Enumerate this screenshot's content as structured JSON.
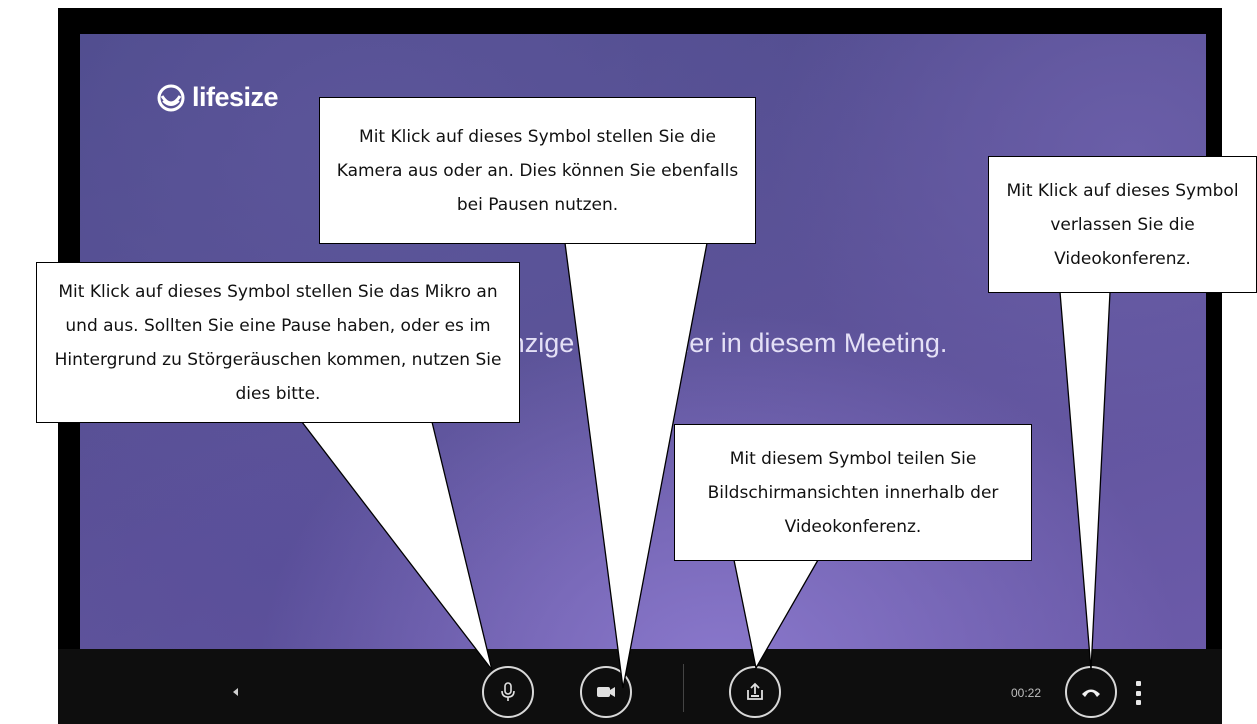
{
  "app": {
    "logo_text": "lifesize"
  },
  "meeting": {
    "message": "Sie sind der einzige Teilnehmer in diesem Meeting."
  },
  "toolbar": {
    "timer": "00:22"
  },
  "icons": {
    "logo": "lifesize-logo-icon",
    "collapse": "triangle-left-icon",
    "mic": "microphone-icon",
    "camera": "video-camera-icon",
    "share": "screen-share-icon",
    "hangup": "phone-hangup-icon",
    "more": "more-vertical-icon"
  },
  "callouts": {
    "mic": "Mit Klick auf dieses Symbol stellen Sie das Mikro an und aus. Sollten Sie eine Pause haben, oder es im Hintergrund zu Störge­räuschen kommen, nutzen Sie dies bitte.",
    "camera": "Mit Klick auf dieses Symbol stellen Sie die Kamera aus oder an. Dies können Sie ebenfalls bei Pausen nutzen.",
    "hangup": "Mit Klick auf dieses Symbol verlassen Sie die Videokonferenz.",
    "share": "Mit diesem Symbol teilen Sie Bildschirmansichten inner­halb der Videokonferenz."
  },
  "colors": {
    "background_top": "#4b4a8a",
    "background_bottom": "#6b5aa9",
    "toolbar": "#0e0e0e",
    "callout": "#ffffff"
  }
}
